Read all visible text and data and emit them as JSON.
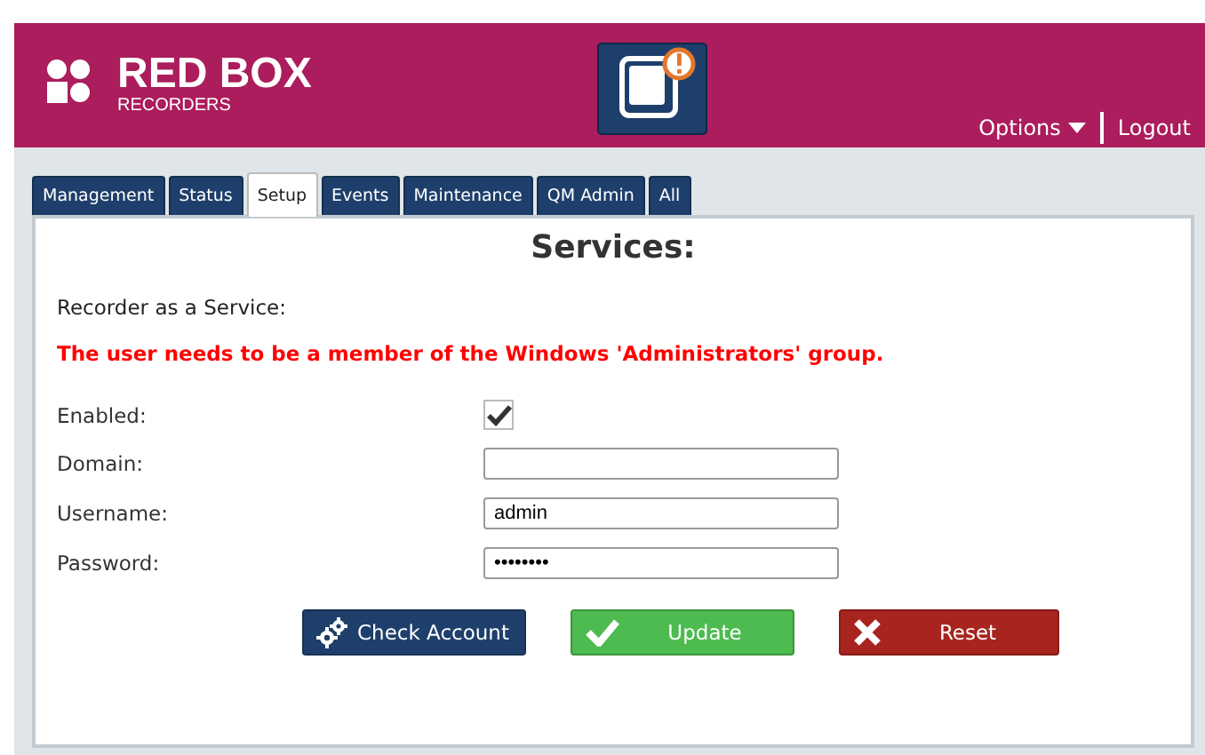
{
  "header": {
    "brand": "RED BOX",
    "brand_sub": "RECORDERS",
    "options": "Options",
    "logout": "Logout"
  },
  "tabs": [
    {
      "label": "Management",
      "selected": false
    },
    {
      "label": "Status",
      "selected": false
    },
    {
      "label": "Setup",
      "selected": true
    },
    {
      "label": "Events",
      "selected": false
    },
    {
      "label": "Maintenance",
      "selected": false
    },
    {
      "label": "QM Admin",
      "selected": false
    },
    {
      "label": "All",
      "selected": false
    }
  ],
  "panel": {
    "title": "Services:",
    "section": "Recorder as a Service:",
    "warning": "The user needs to be a member of the Windows 'Administrators' group."
  },
  "fields": [
    {
      "kind": "checkbox",
      "label": "Enabled:",
      "checked": true
    },
    {
      "kind": "text",
      "label": "Domain:"
    },
    {
      "kind": "text",
      "label": "Username:",
      "value": "admin"
    },
    {
      "kind": "text",
      "label": "Password:",
      "value": "••••••••"
    }
  ],
  "buttons": [
    {
      "kind": "check",
      "label": "Check Account"
    },
    {
      "kind": "update",
      "label": "Update"
    },
    {
      "kind": "reset",
      "label": "Reset"
    }
  ]
}
